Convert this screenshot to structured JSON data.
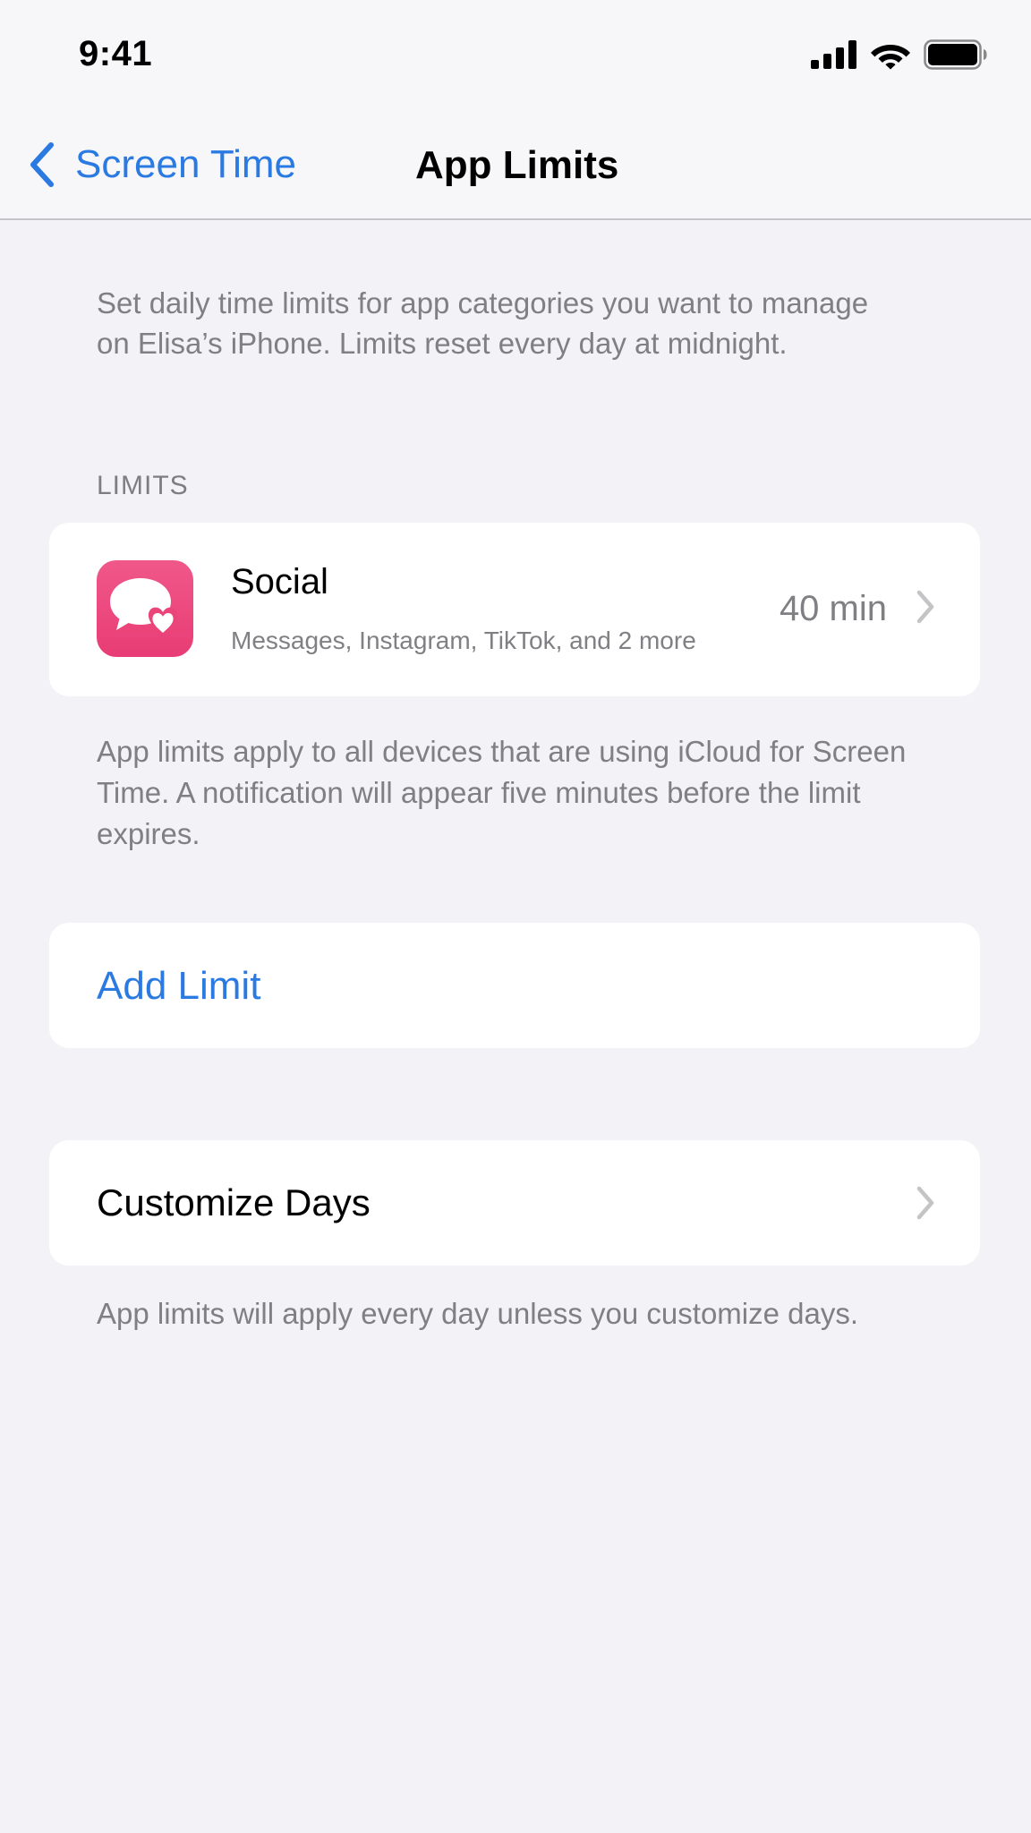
{
  "status_bar": {
    "time": "9:41",
    "icons": [
      "cellular-signal-icon",
      "wifi-icon",
      "battery-icon"
    ]
  },
  "nav": {
    "back_label": "Screen Time",
    "title": "App Limits"
  },
  "intro": "Set daily time limits for app categories you want to manage on Elisa’s iPhone. Limits reset every day at midnight.",
  "limits": {
    "header": "LIMITS",
    "items": [
      {
        "title": "Social",
        "subtitle": "Messages, Instagram, TikTok, and 2 more",
        "value": "40 min",
        "icon": "social-chat-heart-icon"
      }
    ],
    "footer": "App limits apply to all devices that are using iCloud for Screen Time. A notification will appear five minutes before the limit expires."
  },
  "add_limit": {
    "label": "Add Limit"
  },
  "customize": {
    "label": "Customize Days",
    "footer": "App limits will apply every day unless you customize days."
  },
  "colors": {
    "accent": "#2a7ae2",
    "social_icon": "#ea4479",
    "background": "#f2f2f7",
    "secondary_text": "#808084"
  }
}
